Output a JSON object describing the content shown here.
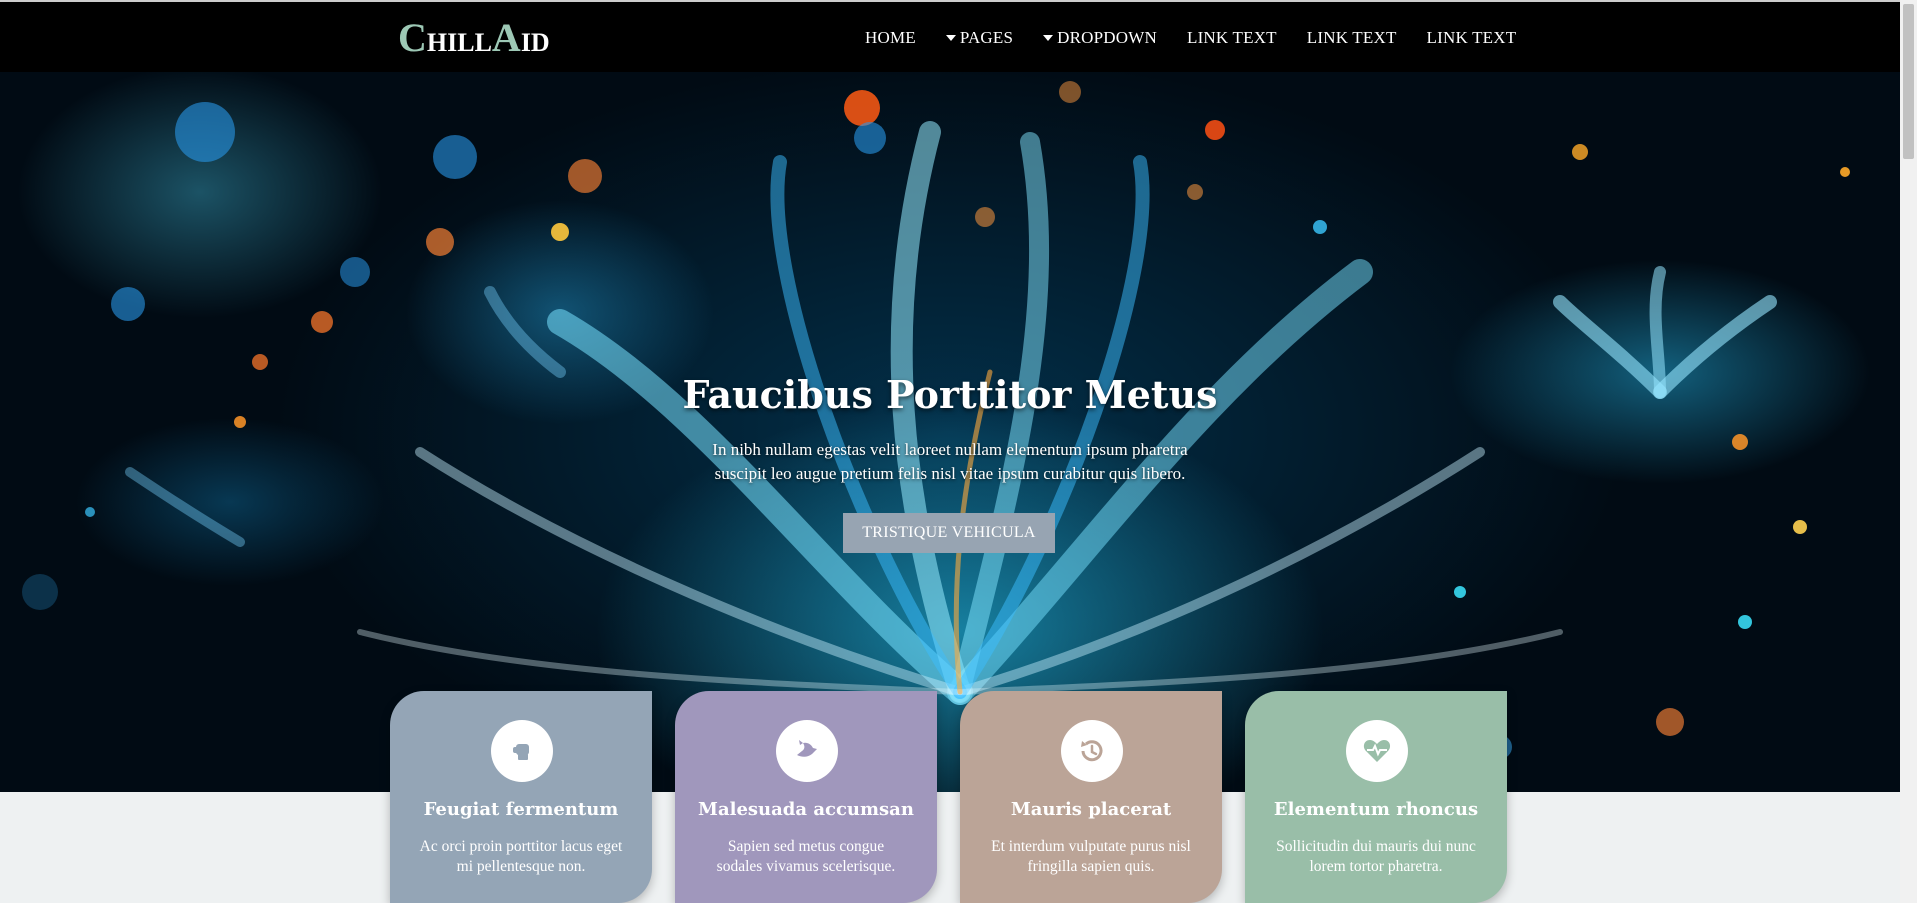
{
  "brand": {
    "c1": "C",
    "r1": "HILL",
    "c2": "A",
    "r2": "ID"
  },
  "nav": {
    "home": "HOME",
    "pages": "PAGES",
    "dropdown": "DROPDOWN",
    "link1": "LINK TEXT",
    "link2": "LINK TEXT",
    "link3": "LINK TEXT"
  },
  "hero": {
    "title": "Faucibus Porttitor Metus",
    "line1": "In nibh nullam egestas velit laoreet nullam elementum ipsum pharetra",
    "line2": "suscipit leo augue pretium felis nisl vitae ipsum curabitur quis libero.",
    "button": "TRISTIQUE VEHICULA"
  },
  "cards": [
    {
      "title": "Feugiat fermentum",
      "line1": "Ac orci proin porttitor lacus eget",
      "line2": "mi pellentesque non.",
      "icon": "fist-icon",
      "color": "#94a5b6"
    },
    {
      "title": "Malesuada accumsan",
      "line1": "Sapien sed metus congue",
      "line2": "sodales vivamus scelerisque.",
      "icon": "dove-icon",
      "color": "#a097bc"
    },
    {
      "title": "Mauris placerat",
      "line1": "Et interdum vulputate purus nisl",
      "line2": "fringilla sapien quis.",
      "icon": "history-icon",
      "color": "#bba497"
    },
    {
      "title": "Elementum rhoncus",
      "line1": "Sollicitudin dui mauris dui nunc",
      "line2": "lorem tortor pharetra.",
      "icon": "heartbeat-icon",
      "color": "#99bea8"
    }
  ]
}
